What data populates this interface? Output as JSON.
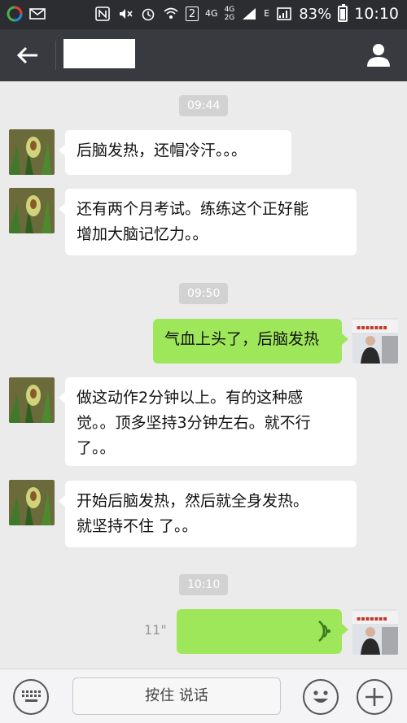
{
  "status_bar": {
    "network_labels": [
      "4G",
      "4G\n2G",
      "E"
    ],
    "sim_label": "2",
    "battery": "83%",
    "time": "10:10"
  },
  "header": {
    "back_icon": "back-arrow-icon",
    "profile_icon": "profile-icon"
  },
  "timestamps": [
    "09:44",
    "09:50",
    "10:10"
  ],
  "messages": [
    {
      "side": "in",
      "text": "后脑发热，还帽冷汗。。。"
    },
    {
      "side": "in",
      "lines": [
        "还有两个月考试。练练这个正好能",
        "增加大脑记忆力。。"
      ]
    },
    {
      "side": "out",
      "text": "气血上头了，后脑发热"
    },
    {
      "side": "in",
      "lines": [
        "做这动作2分钟以上。有的这种感",
        "觉。。顶多坚持3分钟左右。就不行",
        "了。。"
      ]
    },
    {
      "side": "in",
      "lines": [
        "开始后脑发热，然后就全身发热。",
        "就坚持不住 了。。"
      ]
    },
    {
      "side": "out",
      "type": "voice",
      "duration": "11\""
    }
  ],
  "input_bar": {
    "hold_to_talk": "按住 说话",
    "keyboard_icon": "keyboard-icon",
    "emoji_icon": "emoji-icon",
    "plus_icon": "plus-icon"
  },
  "colors": {
    "header_bg": "#393a3f",
    "outgoing_bubble": "#9fe75a",
    "incoming_bubble": "#ffffff",
    "voice_wave": "#4caf50"
  }
}
